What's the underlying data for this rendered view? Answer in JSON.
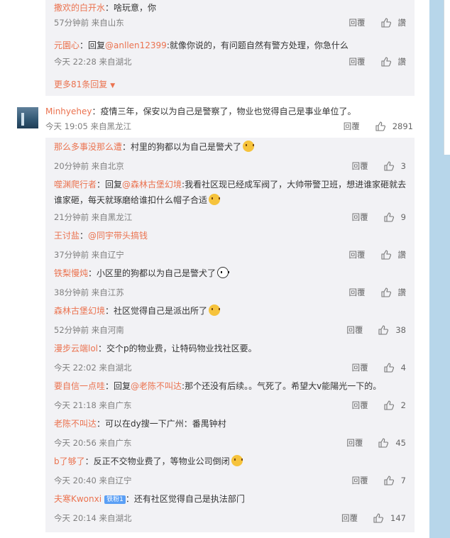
{
  "first_group": {
    "replies": [
      {
        "name": "撒欢的白开水",
        "text": "：啥玩意，你",
        "meta": "57分钟前 来自山东",
        "reply_label": "回覆",
        "like_label": "讚"
      },
      {
        "name": "元園心",
        "prefix": "：回复",
        "at": "@anllen12399",
        "text": ":就像你说的，有问题自然有警方处理，你急什么",
        "meta": "今天 22:28 来自湖北",
        "reply_label": "回覆",
        "like_label": "讚"
      }
    ],
    "more_label": "更多81条回复",
    "more_icon": "▼"
  },
  "top_comment": {
    "name": "Minhyehey",
    "text": "：疫情三年，保安以为自己是警察了，物业也觉得自己是事业单位了。",
    "meta": "今天 19:05 来自黑龙江",
    "reply_label": "回覆",
    "likes": "2891"
  },
  "second_group": {
    "replies": [
      {
        "name": "那么多事没那么遭",
        "text": "：村里的狗都以为自己是警犬了",
        "emoji": "doge-emoji",
        "meta": "20分钟前 来自北京",
        "reply_label": "回覆",
        "like_label": "3"
      },
      {
        "name": "噬渊爬行者",
        "prefix": "：回复",
        "at": "@森林古堡幻境",
        "text": ":我看社区现已经成军阀了，大帅带警卫班，想进谁家砸就去谁家砸，每天就琢磨给谁扣什么帽子合适",
        "emoji": "doge-emoji",
        "meta": "21分钟前 来自黑龙江",
        "reply_label": "回覆",
        "like_label": "9"
      },
      {
        "name": "王讨盐",
        "prefix": "：",
        "at": "@同宇带头搞钱",
        "text": "",
        "meta": "37分钟前 来自辽宁",
        "reply_label": "回覆",
        "like_label": "讚"
      },
      {
        "name": "铁梨慢炖",
        "text": "：小区里的狗都以为自己是警犬了",
        "emoji": "panda-emoji",
        "meta": "38分钟前 来自江苏",
        "reply_label": "回覆",
        "like_label": "讚"
      },
      {
        "name": "森林古堡幻境",
        "text": "：社区觉得自己是派出所了",
        "emoji": "doge-emoji",
        "meta": "52分钟前 来自河南",
        "reply_label": "回覆",
        "like_label": "38"
      },
      {
        "name": "漫步云端lol",
        "text": "：交个p的物业费，让特码物业找社区要。",
        "meta": "今天 22:02 来自湖北",
        "reply_label": "回覆",
        "like_label": "4"
      },
      {
        "name": "要自信一点哇",
        "prefix": "：回复",
        "at": "@老陈不叫达",
        "text": ":那个还没有后续。。气死了。希望大v能陽光一下的。",
        "meta": "今天 21:18 来自广东",
        "reply_label": "回覆",
        "like_label": "2"
      },
      {
        "name": "老陈不叫达",
        "text": "：可以在dy搜一下广州：番禺钟村",
        "meta": "今天 20:56 来自广东",
        "reply_label": "回覆",
        "like_label": "45"
      },
      {
        "name": "b了够了",
        "text": "：反正不交物业费了，等物业公司倒闭",
        "emoji": "grin-emoji",
        "meta": "今天 20:40 来自辽宁",
        "reply_label": "回覆",
        "like_label": "7"
      },
      {
        "name": "夫寒Kwonxi",
        "badge": "铁粉1",
        "text": "：还有社区觉得自己是执法部门",
        "meta": "今天 20:14 来自湖北",
        "reply_label": "回覆",
        "like_label": "147"
      }
    ]
  }
}
